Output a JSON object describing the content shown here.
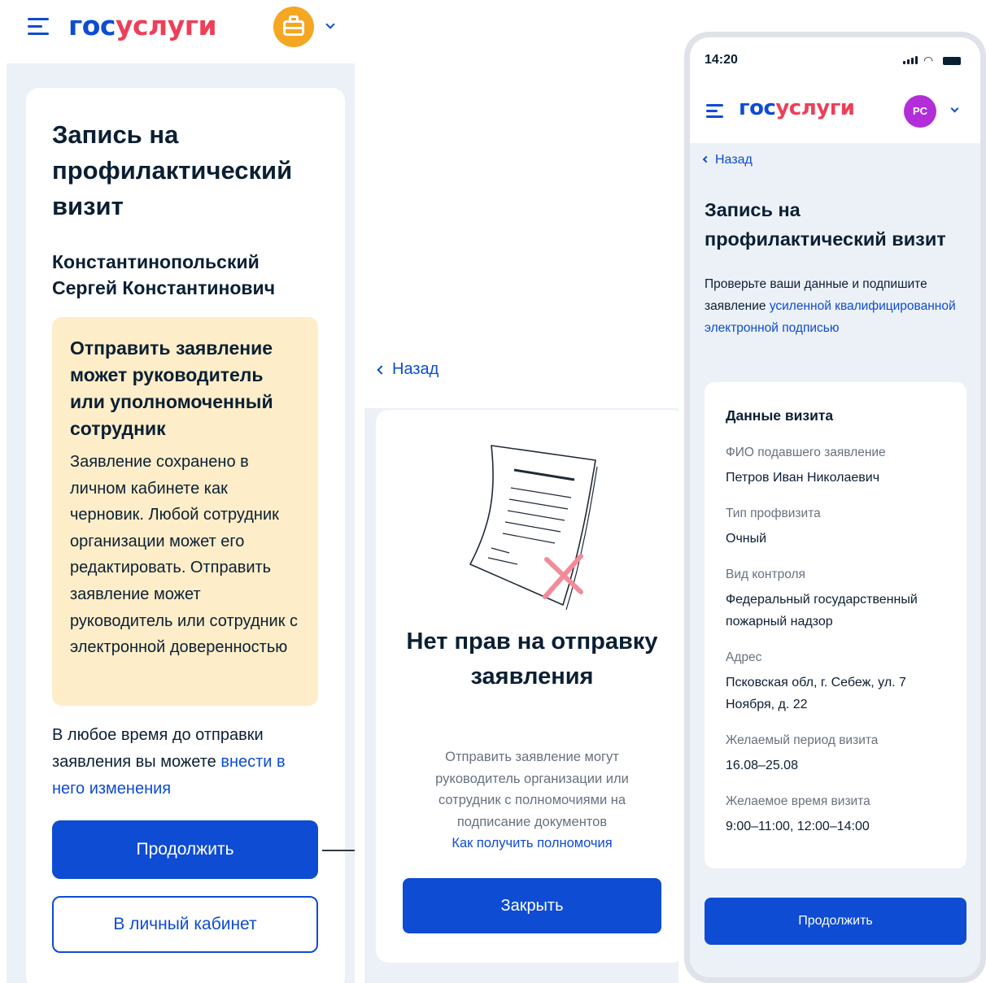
{
  "brand": {
    "part1": "гос",
    "part2": "услуги"
  },
  "panel1": {
    "title": "Запись на профилактический визит",
    "person": "Константинопольский Сергей Константинович",
    "warning": {
      "title": "Отправить заявление может руководитель или уполномоченный сотрудник",
      "body": "Заявление сохранено в личном кабинете как черновик. Любой сотрудник организации может его редактировать. Отправить заявление может руководитель или сотрудник с электронной доверенностью"
    },
    "anytime_text": "В любое время до отправки заявления вы можете ",
    "anytime_link": "внести в него изменения",
    "continue_label": "Продолжить",
    "cabinet_label": "В личный кабинет"
  },
  "panel2": {
    "back_label": "Назад",
    "title": "Нет прав на отправку заявления",
    "description": "Отправить заявление могут руководитель организации или сотрудник с полномочиями на подписание документов",
    "link": "Как получить полномочия",
    "close_label": "Закрыть"
  },
  "panel3": {
    "time": "14:20",
    "avatar_initials": "PC",
    "back_label": "Назад",
    "title": "Запись на профилактический визит",
    "intro_text": "Проверьте ваши данные и подпишите заявление ",
    "intro_link": "усиленной квалифицированной электронной подписью",
    "card_title": "Данные визита",
    "fields": [
      {
        "label": "ФИО подавшего заявление",
        "value": "Петров Иван Николаевич"
      },
      {
        "label": "Тип профвизита",
        "value": "Очный"
      },
      {
        "label": "Вид контроля",
        "value": "Федеральный государственный пожарный надзор"
      },
      {
        "label": "Адрес",
        "value": "Псковская обл, г. Себеж, ул. 7 Ноября, д. 22"
      },
      {
        "label": "Желаемый период визита",
        "value": "16.08–25.08"
      },
      {
        "label": "Желаемое время визита",
        "value": "9:00–11:00, 12:00–14:00"
      }
    ],
    "continue_label": "Продолжить"
  },
  "colors": {
    "primary": "#0d4cd3",
    "brand_red": "#ee3f58",
    "warning_bg": "#fdedc8",
    "page_bg": "#ecf1f8",
    "org_avatar": "#f5a623",
    "user_avatar": "#b22ed8",
    "error_cross": "#f28c98"
  },
  "icons": {
    "menu": "burger-menu-icon",
    "org": "briefcase-icon",
    "dropdown": "chevron-down-icon",
    "back": "chevron-left-icon",
    "illustration": "rejected-document-icon"
  }
}
